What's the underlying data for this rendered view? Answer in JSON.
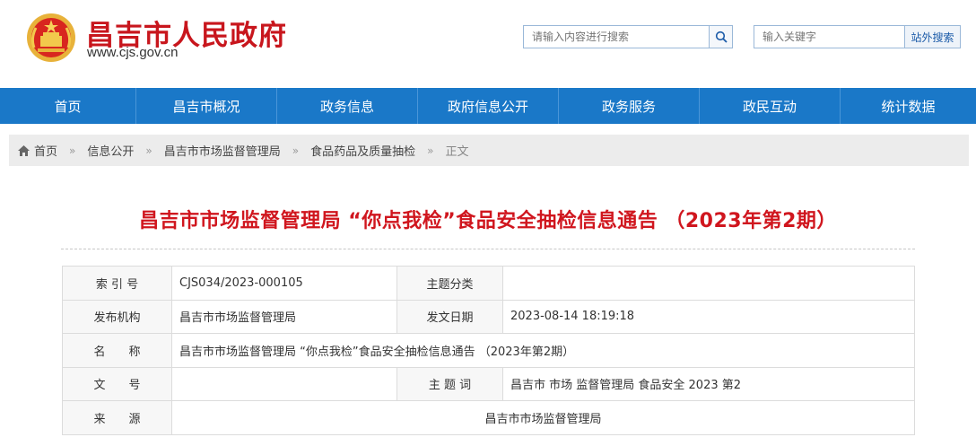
{
  "header": {
    "site_title": "昌吉市人民政府",
    "site_url": "www.cjs.gov.cn",
    "search_placeholder": "请输入内容进行搜索",
    "keyword_placeholder": "输入关键字",
    "site_search_button": "站外搜索"
  },
  "nav": {
    "items": [
      {
        "label": "首页"
      },
      {
        "label": "昌吉市概况"
      },
      {
        "label": "政务信息"
      },
      {
        "label": "政府信息公开"
      },
      {
        "label": "政务服务"
      },
      {
        "label": "政民互动"
      },
      {
        "label": "统计数据"
      }
    ]
  },
  "breadcrumb": {
    "items": [
      "首页",
      "信息公开",
      "昌吉市市场监督管理局",
      "食品药品及质量抽检",
      "正文"
    ],
    "separator": "»"
  },
  "article": {
    "title": "昌吉市市场监督管理局 “你点我检”食品安全抽检信息通告 （2023年第2期）"
  },
  "meta": {
    "index_label": "索 引 号",
    "index_value": "CJS034/2023-000105",
    "category_label": "主题分类",
    "category_value": "",
    "publisher_label": "发布机构",
    "publisher_value": "昌吉市市场监督管理局",
    "date_label": "发文日期",
    "date_value": "2023-08-14 18:19:18",
    "name_label": "名　　称",
    "name_value": "昌吉市市场监督管理局 “你点我检”食品安全抽检信息通告 （2023年第2期）",
    "doc_no_label": "文　　号",
    "doc_no_value": "",
    "keywords_label": "主 题 词",
    "keywords_value": "昌吉市 市场 监督管理局 食品安全 2023 第2",
    "source_label": "来　　源",
    "source_value": "昌吉市市场监督管理局"
  },
  "colors": {
    "brand_red": "#c8161d",
    "nav_blue": "#1a78c8"
  }
}
